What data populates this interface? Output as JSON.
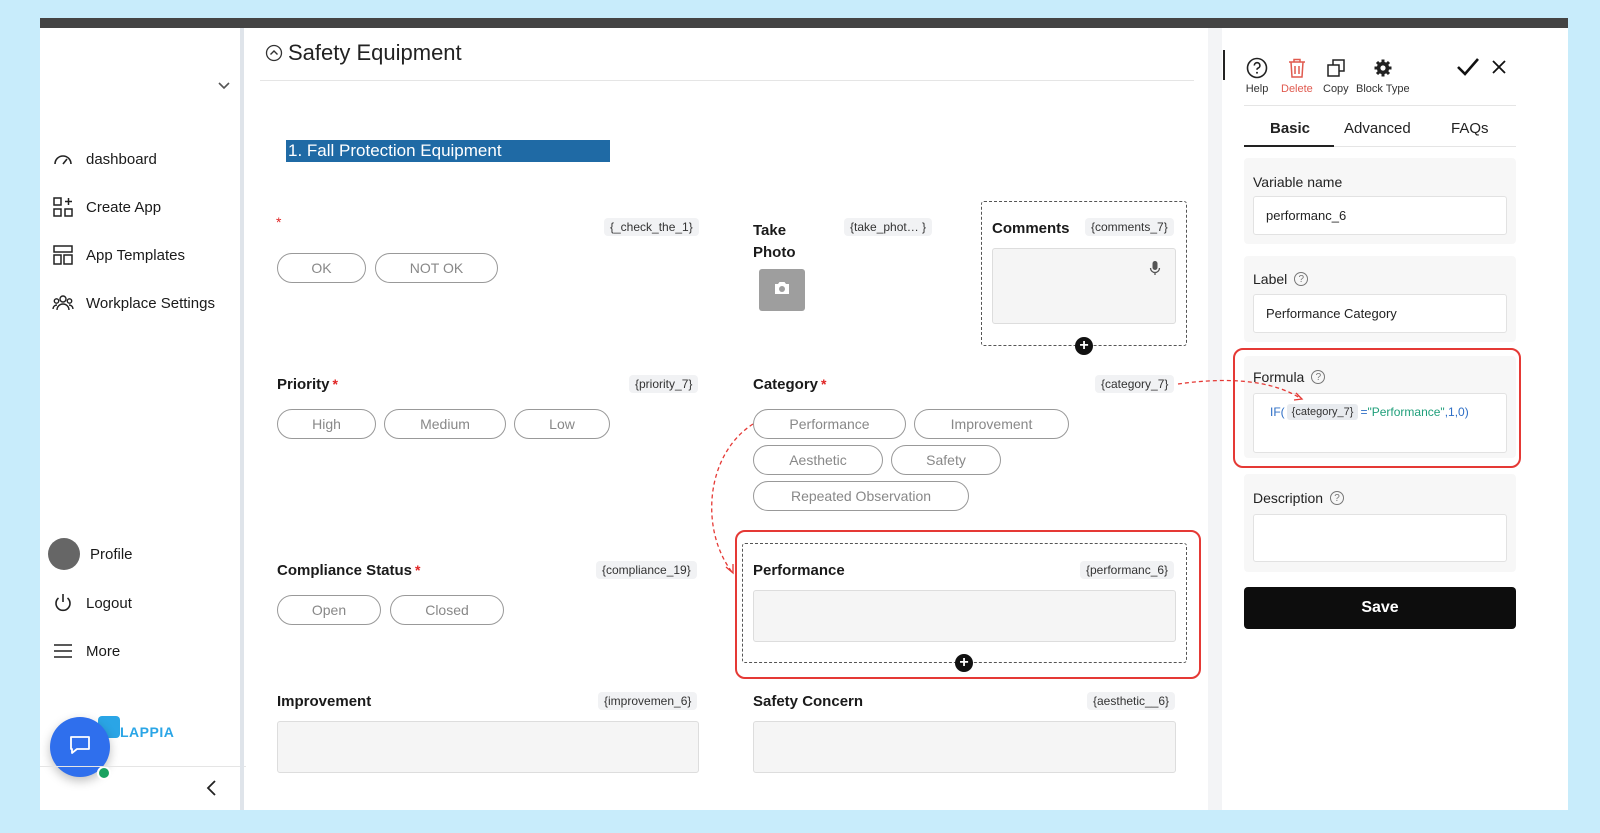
{
  "sidebar": {
    "nav": [
      "dashboard",
      "Create App",
      "App Templates",
      "Workplace Settings"
    ],
    "profile_label": "Profile",
    "logout_label": "Logout",
    "more_label": "More",
    "brand": "LAPPIA"
  },
  "section": {
    "title": "Safety Equipment",
    "banner": "1. Fall Protection Equipment"
  },
  "fields": {
    "check": {
      "var": "{_check_the_1}",
      "options": [
        "OK",
        "NOT OK"
      ]
    },
    "photo": {
      "label_line1": "Take",
      "label_line2": "Photo",
      "var": "{take_phot… }"
    },
    "comments": {
      "label": "Comments",
      "var": "{comments_7}"
    },
    "priority": {
      "label": "Priority",
      "var": "{priority_7}",
      "options": [
        "High",
        "Medium",
        "Low"
      ]
    },
    "category": {
      "label": "Category",
      "var": "{category_7}",
      "options": [
        "Performance",
        "Improvement",
        "Aesthetic",
        "Safety",
        "Repeated Observation"
      ]
    },
    "compliance": {
      "label": "Compliance Status",
      "var": "{compliance_19}",
      "options": [
        "Open",
        "Closed"
      ]
    },
    "performance": {
      "label": "Performance",
      "var": "{performanc_6}"
    },
    "improvement": {
      "label": "Improvement",
      "var": "{improvemen_6}"
    },
    "safety_concern": {
      "label": "Safety Concern",
      "var": "{aesthetic__6}"
    }
  },
  "panel": {
    "tools": [
      "Help",
      "Delete",
      "Copy",
      "Block Type"
    ],
    "tabs": [
      "Basic",
      "Advanced",
      "FAQs"
    ],
    "variable_name": {
      "label": "Variable name",
      "value": "performanc_6"
    },
    "label_field": {
      "label": "Label",
      "value": "Performance Category"
    },
    "formula": {
      "label": "Formula",
      "prefix": "IF(",
      "chip": "{category_7}",
      "op": "=",
      "str": "\"Performance\"",
      "suffix": ",1,0)"
    },
    "description": {
      "label": "Description"
    },
    "save_label": "Save"
  },
  "colors": {
    "banner": "#1f6aa5",
    "highlight": "#e53935",
    "fab": "#2f6fed",
    "save": "#0d0d0d"
  }
}
